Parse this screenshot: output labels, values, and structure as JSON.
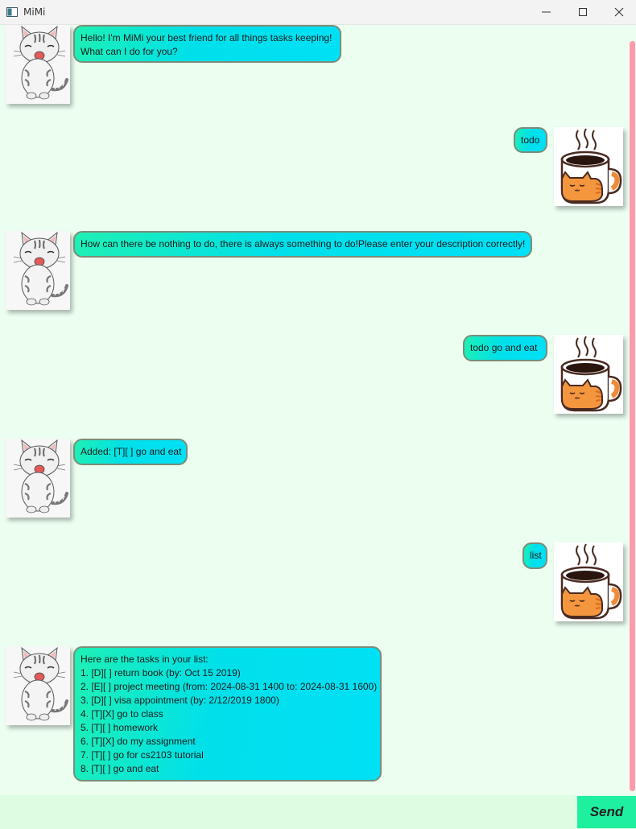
{
  "window": {
    "title": "MiMi",
    "controls": [
      "minimize-icon",
      "maximize-icon",
      "close-icon"
    ]
  },
  "messages": [
    {
      "sender": "bot",
      "avatar": "kitten-icon",
      "text": "Hello! I'm MiMi your best friend for all things tasks keeping!\nWhat can I do for you?"
    },
    {
      "sender": "user",
      "avatar": "coffee-cat-mug-icon",
      "text": "todo"
    },
    {
      "sender": "bot",
      "avatar": "kitten-icon",
      "text": "How can there be nothing to do, there is always something to do!Please enter your description correctly!"
    },
    {
      "sender": "user",
      "avatar": "coffee-cat-mug-icon",
      "text": "todo go and eat"
    },
    {
      "sender": "bot",
      "avatar": "kitten-icon",
      "text": "Added: [T][ ] go and eat"
    },
    {
      "sender": "user",
      "avatar": "coffee-cat-mug-icon",
      "text": "list"
    },
    {
      "sender": "bot",
      "avatar": "kitten-icon",
      "text": "Here are the tasks in your list:\n1. [D][ ] return book (by: Oct 15 2019)\n2. [E][ ] project meeting (from: 2024-08-31 1400 to: 2024-08-31 1600)\n3. [D][ ] visa appointment (by: 2/12/2019 1800)\n4. [T][X] go to class\n5. [T][ ] homework\n6. [T][X] do my assignment\n7. [T][ ] go for cs2103 tutorial\n8. [T][ ] go and eat"
    }
  ],
  "input": {
    "value": "",
    "placeholder": ""
  },
  "send_label": "Send",
  "colors": {
    "chat_background": "#ecfef0",
    "bubble_gradient_start": "#1ef0b4",
    "bubble_gradient_end": "#00e0f6",
    "bubble_border": "#7a8d78",
    "scrollbar": "#ff9aac",
    "input_background": "#dcfde2",
    "send_button": "#1ef0a0"
  }
}
